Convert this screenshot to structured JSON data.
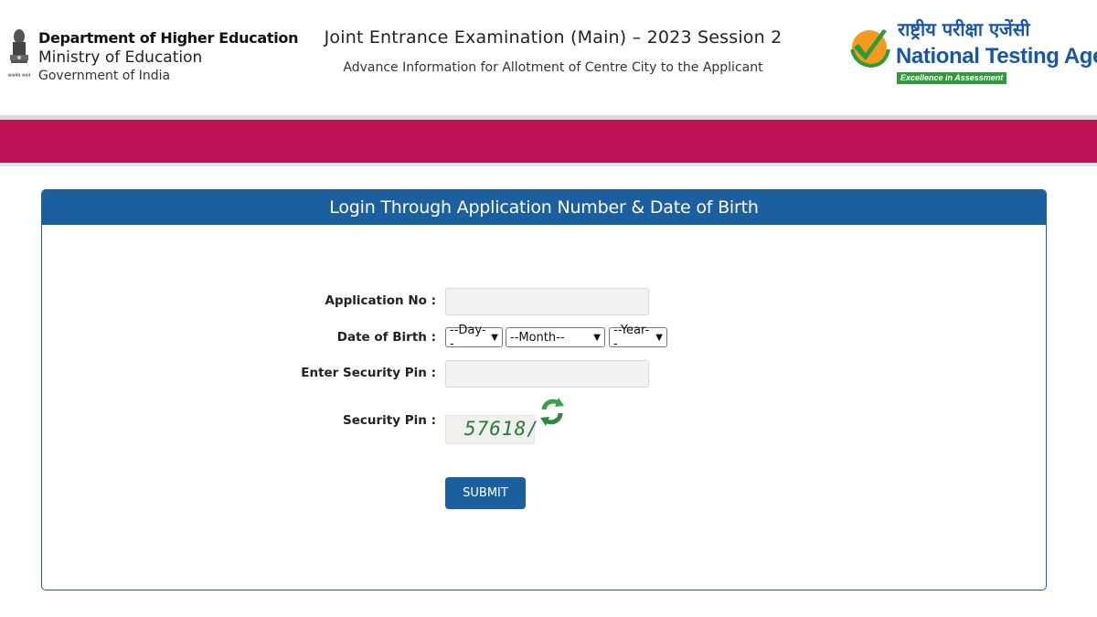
{
  "header": {
    "dept_line1": "Department of Higher Education",
    "dept_line2": "Ministry of Education",
    "dept_line3": "Government of India",
    "exam_title": "Joint Entrance Examination (Main) – 2023 Session 2",
    "exam_subtitle": "Advance Information for Allotment of Centre City to the Applicant",
    "nta_hindi": "राष्ट्रीय परीक्षा एजेंसी",
    "nta_english": "National Testing Agency",
    "nta_tagline": "Excellence in Assessment"
  },
  "colors": {
    "band": "#bd1357",
    "panel_header": "#1c5f9e",
    "nta_blue": "#1a56a8"
  },
  "login": {
    "heading": "Login Through Application Number & Date of Birth",
    "application_no_label": "Application No :",
    "application_no_value": "",
    "dob_label": "Date of Birth :",
    "day_selected": "--Day--",
    "month_selected": "--Month--",
    "year_selected": "--Year--",
    "security_pin_input_label": "Enter Security Pin :",
    "security_pin_value": "",
    "security_pin_label": "Security Pin :",
    "captcha_text": "57618/",
    "refresh_icon": "refresh-icon",
    "submit_label": "SUBMIT"
  }
}
